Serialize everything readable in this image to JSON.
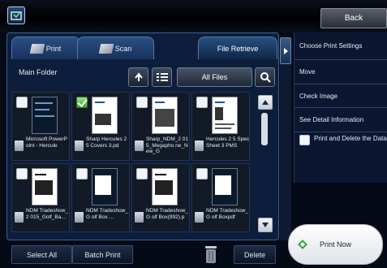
{
  "header": {
    "back_label": "Back"
  },
  "tabs": [
    {
      "label": "Print"
    },
    {
      "label": "Scan"
    },
    {
      "label": "File Retrieve"
    }
  ],
  "folder": {
    "title": "Main Folder",
    "filter_label": "All Files"
  },
  "files": [
    {
      "name": "Microsoft PowerPoint - Hercule",
      "checked": false,
      "thumb": "dark"
    },
    {
      "name": "Sharp Hercules 2 5 Covers 3.pd",
      "checked": true,
      "thumb": "light"
    },
    {
      "name": "Sharp_NDM_2 015_Megapho ne_New_G",
      "checked": false,
      "thumb": "light"
    },
    {
      "name": "Hercules 2 5 Spec Sheet 3 PMS",
      "checked": false,
      "thumb": "light"
    },
    {
      "name": "NDM Tradeshow_2 015_Golf_Ba...",
      "checked": false,
      "thumb": "light"
    },
    {
      "name": "NDM Tradeshow_G olf Box ...",
      "checked": false,
      "thumb": "dark"
    },
    {
      "name": "NDM Tradeshow_G olf Box(992).p",
      "checked": false,
      "thumb": "light"
    },
    {
      "name": "NDM Tradeshow_G olf Boxpdf",
      "checked": false,
      "thumb": "dark"
    }
  ],
  "bottom": {
    "select_all": "Select All",
    "batch_print": "Batch Print",
    "delete": "Delete"
  },
  "menu": {
    "items": [
      {
        "label": "Choose Print Settings"
      },
      {
        "label": "Move"
      },
      {
        "label": "Check Image"
      },
      {
        "label": "See Detail Information"
      }
    ],
    "print_delete_label": "Print and Delete the Data"
  },
  "print_now_label": "Print Now"
}
